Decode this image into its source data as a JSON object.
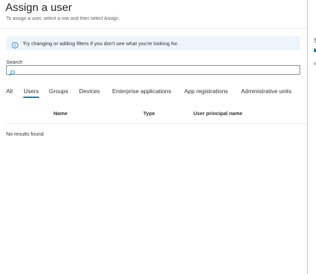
{
  "header": {
    "title": "Assign a user",
    "subtitle": "To assign a user, select a row and then select Assign."
  },
  "info": {
    "icon": "info-icon",
    "text": "Try changing or adding filters if you don't see what you're looking for.",
    "background": "#eef4fb"
  },
  "search": {
    "label": "Search",
    "value": "",
    "icon": "search-icon"
  },
  "tabs": {
    "active": "Users",
    "accent": "#0078d4",
    "items": [
      {
        "label": "All"
      },
      {
        "label": "Users"
      },
      {
        "label": "Groups"
      },
      {
        "label": "Devices"
      },
      {
        "label": "Enterprise applications"
      },
      {
        "label": "App registrations"
      },
      {
        "label": "Administrative units"
      }
    ]
  },
  "table": {
    "columns": [
      "Name",
      "Type",
      "User principal name"
    ],
    "empty_message": "No results found"
  },
  "side_panel": {
    "letter_s": "S",
    "letter_n": "N"
  }
}
